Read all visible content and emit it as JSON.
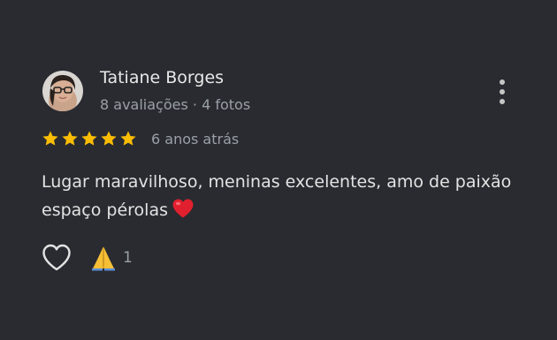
{
  "review": {
    "author_name": "Tatiane Borges",
    "author_meta": "8 avaliações · 4 fotos",
    "rating": 5,
    "max_rating": 5,
    "time_ago": "6 anos atrás",
    "text": "Lugar maravilhoso, meninas excelentes, amo de paixão espaço pérolas",
    "text_emoji": "red-heart-emoji",
    "reaction_emoji": "folded-hands-emoji",
    "reaction_count": "1"
  },
  "icons": {
    "avatar": "avatar",
    "menu": "more-vertical-icon",
    "star": "star-icon",
    "like": "heart-outline-icon"
  },
  "colors": {
    "background": "#292b31",
    "primary_text": "#e3e3e3",
    "secondary_text": "#9aa0a6",
    "star": "#fbbc04",
    "heart": "#e0202e"
  }
}
